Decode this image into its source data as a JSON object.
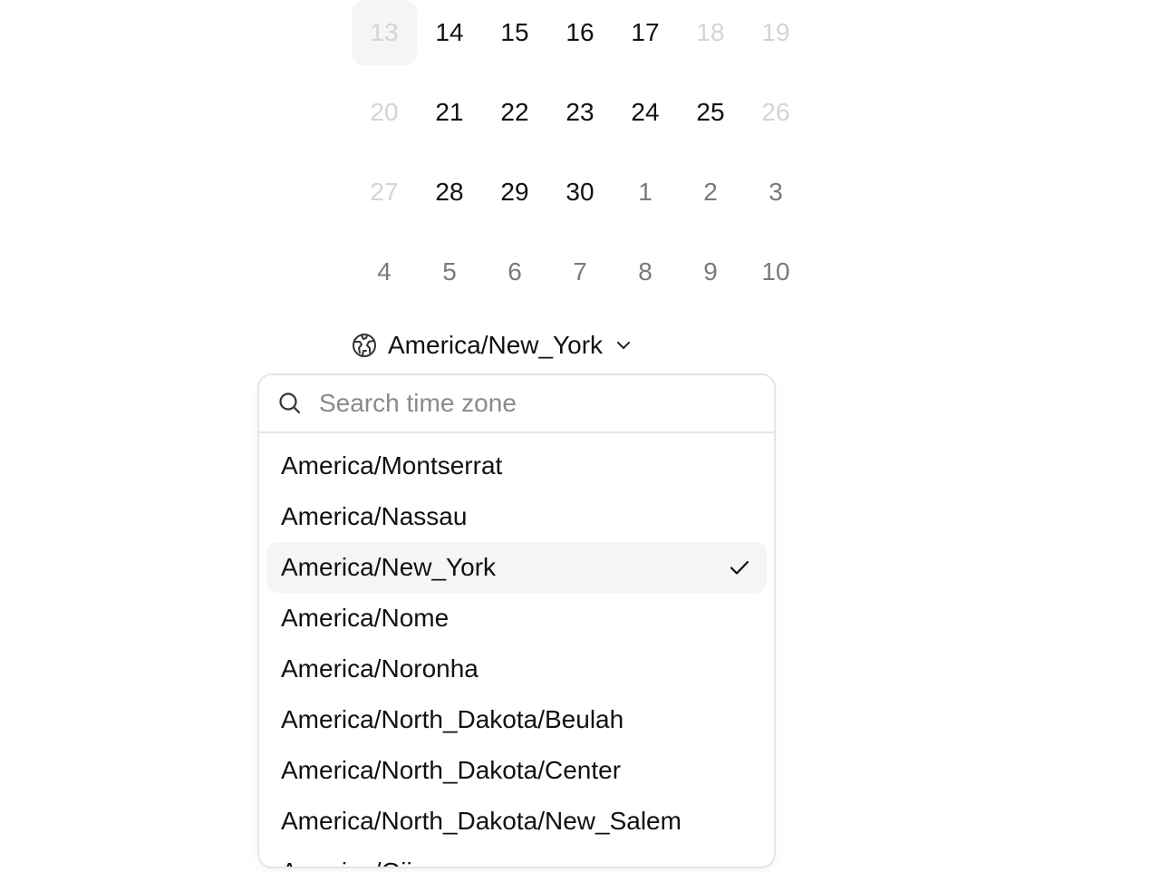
{
  "calendar": {
    "weeks": [
      [
        {
          "d": "13",
          "state": "today-disabled"
        },
        {
          "d": "14",
          "state": "available"
        },
        {
          "d": "15",
          "state": "available"
        },
        {
          "d": "16",
          "state": "available"
        },
        {
          "d": "17",
          "state": "available"
        },
        {
          "d": "18",
          "state": "disabled"
        },
        {
          "d": "19",
          "state": "disabled"
        }
      ],
      [
        {
          "d": "20",
          "state": "disabled"
        },
        {
          "d": "21",
          "state": "available"
        },
        {
          "d": "22",
          "state": "available"
        },
        {
          "d": "23",
          "state": "available"
        },
        {
          "d": "24",
          "state": "available"
        },
        {
          "d": "25",
          "state": "available"
        },
        {
          "d": "26",
          "state": "disabled"
        }
      ],
      [
        {
          "d": "27",
          "state": "disabled"
        },
        {
          "d": "28",
          "state": "available"
        },
        {
          "d": "29",
          "state": "available"
        },
        {
          "d": "30",
          "state": "available"
        },
        {
          "d": "1",
          "state": "outside"
        },
        {
          "d": "2",
          "state": "outside"
        },
        {
          "d": "3",
          "state": "outside"
        }
      ],
      [
        {
          "d": "4",
          "state": "outside"
        },
        {
          "d": "5",
          "state": "outside"
        },
        {
          "d": "6",
          "state": "outside"
        },
        {
          "d": "7",
          "state": "outside"
        },
        {
          "d": "8",
          "state": "outside"
        },
        {
          "d": "9",
          "state": "outside"
        },
        {
          "d": "10",
          "state": "outside"
        }
      ]
    ]
  },
  "timezone": {
    "selected_label": "America/New_York",
    "icon": "globe-icon"
  },
  "search": {
    "placeholder": "Search time zone",
    "value": ""
  },
  "options": [
    {
      "label": "America/Montserrat",
      "selected": false
    },
    {
      "label": "America/Nassau",
      "selected": false
    },
    {
      "label": "America/New_York",
      "selected": true
    },
    {
      "label": "America/Nome",
      "selected": false
    },
    {
      "label": "America/Noronha",
      "selected": false
    },
    {
      "label": "America/North_Dakota/Beulah",
      "selected": false
    },
    {
      "label": "America/North_Dakota/Center",
      "selected": false
    },
    {
      "label": "America/North_Dakota/New_Salem",
      "selected": false
    },
    {
      "label": "America/Ojinaga",
      "selected": false
    }
  ],
  "colors": {
    "text": "#111111",
    "disabled": "#d4d4d4",
    "outside": "#7a7a7a",
    "highlight": "#f5f5f5",
    "border": "#e5e5e5"
  }
}
